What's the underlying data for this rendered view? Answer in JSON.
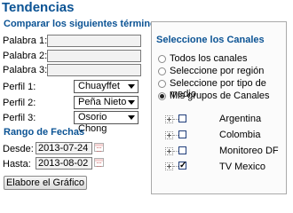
{
  "page": {
    "title": "Tendencias"
  },
  "compare": {
    "heading": "Comparar los siguientes términos",
    "words": [
      {
        "label": "Palabra 1:",
        "value": ""
      },
      {
        "label": "Palabra 2:",
        "value": ""
      },
      {
        "label": "Palabra 3:",
        "value": ""
      }
    ],
    "profiles": [
      {
        "label": "Perfil 1:",
        "value": "Chuayffet"
      },
      {
        "label": "Perfil 2:",
        "value": "Peña Nieto"
      },
      {
        "label": "Perfil 3:",
        "value": "Osorio Chong"
      }
    ]
  },
  "dates": {
    "heading": "Rango de Fechas",
    "from_label": "Desde:",
    "from_value": "2013-07-24",
    "to_label": "Hasta:",
    "to_value": "2013-08-02"
  },
  "actions": {
    "generate_label": "Elabore el Gráfico"
  },
  "channels": {
    "heading": "Seleccione los Canales",
    "options": [
      {
        "label": "Todos los canales",
        "checked": false
      },
      {
        "label": "Seleccione por región",
        "checked": false
      },
      {
        "label": "Seleccione por tipo de medio",
        "checked": false
      },
      {
        "label": "Mis grupos de Canales",
        "checked": true
      }
    ],
    "groups": [
      {
        "label": "Argentina",
        "checked": false
      },
      {
        "label": "Colombia",
        "checked": false
      },
      {
        "label": "Monitoreo DF",
        "checked": false
      },
      {
        "label": "TV Mexico",
        "checked": true
      }
    ]
  }
}
